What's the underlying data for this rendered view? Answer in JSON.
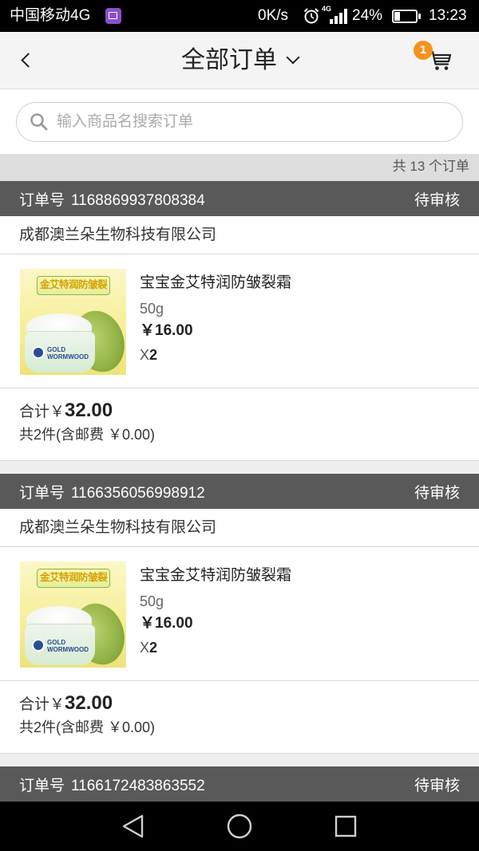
{
  "theme": {
    "status_bar_bg": "#000000",
    "header_bg": "#f4f4f4",
    "page_bg": "#eeeeee",
    "summary_bar_bg": "#dddddd",
    "order_header_bg": "#595959",
    "badge_bg": "#f5921e",
    "nav_bar_bg": "#000000",
    "notification_icon_bg": "#8a4fd0"
  },
  "status_bar": {
    "carrier": "中国移动4G",
    "notification_icon": "gallery-icon",
    "net_speed": "0K/s",
    "alarm_icon": "alarm-clock-icon",
    "network_type": "4G",
    "signal_icon": "signal-bars-icon",
    "battery": "24%",
    "battery_icon": "battery-icon",
    "time": "13:23"
  },
  "header": {
    "back_icon": "chevron-left-icon",
    "title": "全部订单",
    "title_dropdown_icon": "chevron-down-icon",
    "cart_icon": "cart-icon",
    "cart_badge": "1"
  },
  "search": {
    "icon": "search-icon",
    "placeholder": "输入商品名搜索订单",
    "value": ""
  },
  "summary": {
    "text": "共 13 个订单"
  },
  "orders": [
    {
      "order_no_label": "订单号",
      "order_no": "1168869937808384",
      "status": "待审核",
      "store": "成都澳兰朵生物科技有限公司",
      "items": [
        {
          "name": "宝宝金艾特润防皱裂霜",
          "spec": "50g",
          "price": "￥16.00",
          "qty_prefix": "X",
          "qty": "2",
          "image": {
            "title": "金艾特润防皱裂",
            "brand_line1": "GOLD",
            "brand_line2": "WORMWOOD"
          }
        }
      ],
      "total_label": "合计",
      "total_currency": "￥",
      "total_amount": "32.00",
      "summary_text": "共2件(含邮费 ￥0.00)"
    },
    {
      "order_no_label": "订单号",
      "order_no": "1166356056998912",
      "status": "待审核",
      "store": "成都澳兰朵生物科技有限公司",
      "items": [
        {
          "name": "宝宝金艾特润防皱裂霜",
          "spec": "50g",
          "price": "￥16.00",
          "qty_prefix": "X",
          "qty": "2",
          "image": {
            "title": "金艾特润防皱裂",
            "brand_line1": "GOLD",
            "brand_line2": "WORMWOOD"
          }
        }
      ],
      "total_label": "合计",
      "total_currency": "￥",
      "total_amount": "32.00",
      "summary_text": "共2件(含邮费 ￥0.00)"
    },
    {
      "order_no_label": "订单号",
      "order_no": "1166172483863552",
      "status": "待审核"
    }
  ],
  "nav_bar": {
    "back_icon": "back-triangle-icon",
    "home_icon": "home-circle-icon",
    "recents_icon": "recents-square-icon"
  }
}
